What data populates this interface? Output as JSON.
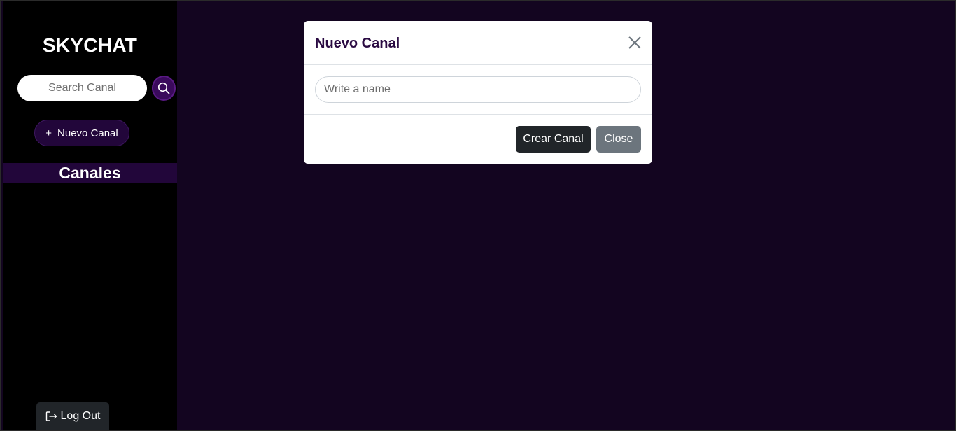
{
  "app": {
    "brand": "SKYCHAT",
    "colors": {
      "main_bg": "#130520",
      "sidebar_bg": "#000000",
      "accent": "#22063a",
      "accent_button": "#3a0a5c"
    }
  },
  "sidebar": {
    "search": {
      "placeholder": "Search Canal",
      "icon": "search-icon"
    },
    "new_channel": {
      "icon": "plus",
      "label": "Nuevo Canal"
    },
    "channels_header": "Canales",
    "logout": {
      "icon": "logout-icon",
      "label": "Log Out"
    }
  },
  "modal": {
    "title": "Nuevo Canal",
    "close_icon": "close-icon",
    "name_input": {
      "placeholder": "Write a name",
      "value": ""
    },
    "create_label": "Crear Canal",
    "close_label": "Close"
  }
}
